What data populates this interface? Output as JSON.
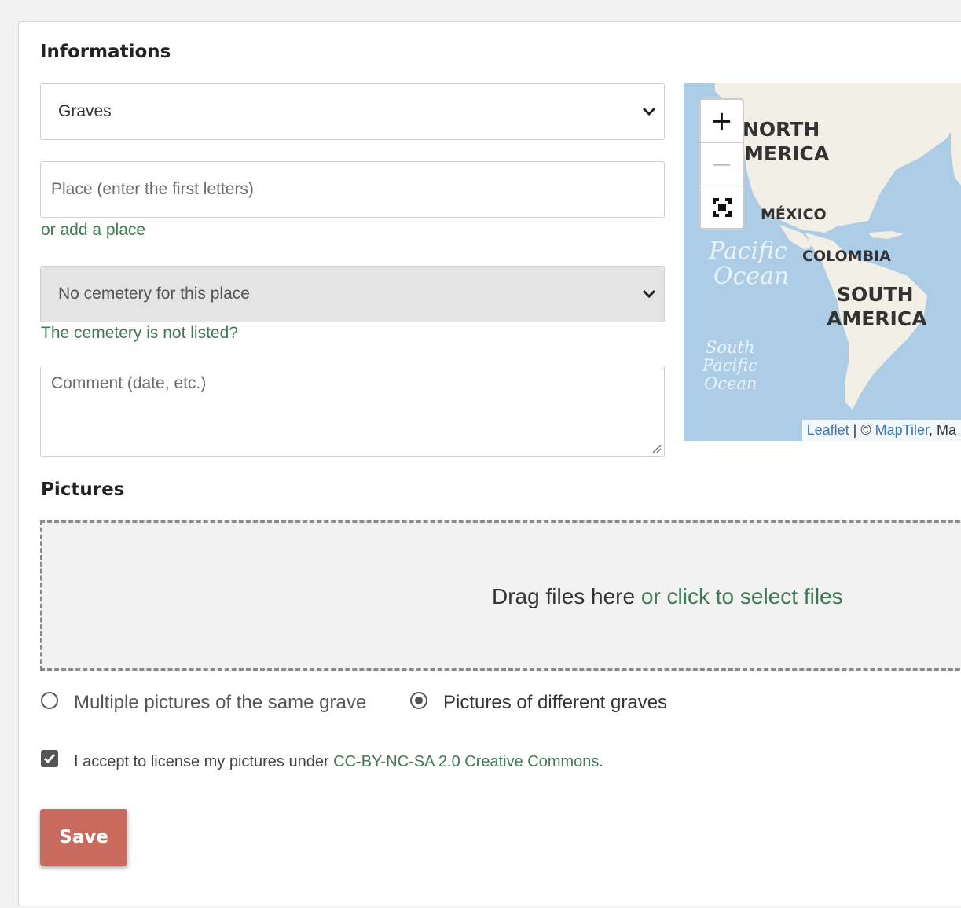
{
  "informations": {
    "title": "Informations",
    "type_select": {
      "value": "Graves"
    },
    "place_input": {
      "placeholder": "Place (enter the first letters)"
    },
    "add_place_link": "or add a place",
    "cemetery_select": {
      "value": "No cemetery for this place"
    },
    "cemetery_not_listed_link": "The cemetery is not listed?",
    "comment_textarea": {
      "placeholder": "Comment (date, etc.)"
    }
  },
  "map": {
    "zoom_in": "+",
    "zoom_out": "−",
    "labels": {
      "north_america_1": "NORTH",
      "north_america_2": "MERICA",
      "mexico": "MÉXICO",
      "colombia": "COLOMBIA",
      "south_america_1": "SOUTH",
      "south_america_2": "AMERICA",
      "pacific_1": "Pacific",
      "pacific_2": "Ocean",
      "south_pacific_1": "South",
      "south_pacific_2": "Pacific",
      "south_pacific_3": "Ocean"
    },
    "attribution": {
      "leaflet": "Leaflet",
      "separator": " | © ",
      "maptiler": "MapTiler",
      "rest": ", Ma"
    }
  },
  "pictures": {
    "title": "Pictures",
    "drop_text": "Drag files here ",
    "drop_link": "or click to select files",
    "radio_same": "Multiple pictures of the same grave",
    "radio_different": "Pictures of different graves",
    "license_text": "I accept to license my pictures under ",
    "license_link": "CC-BY-NC-SA 2.0 Creative Commons",
    "license_end": "."
  },
  "save_label": "Save",
  "colors": {
    "link": "#3f7a55",
    "save": "#c86a5d",
    "map_water": "#adcde6"
  }
}
